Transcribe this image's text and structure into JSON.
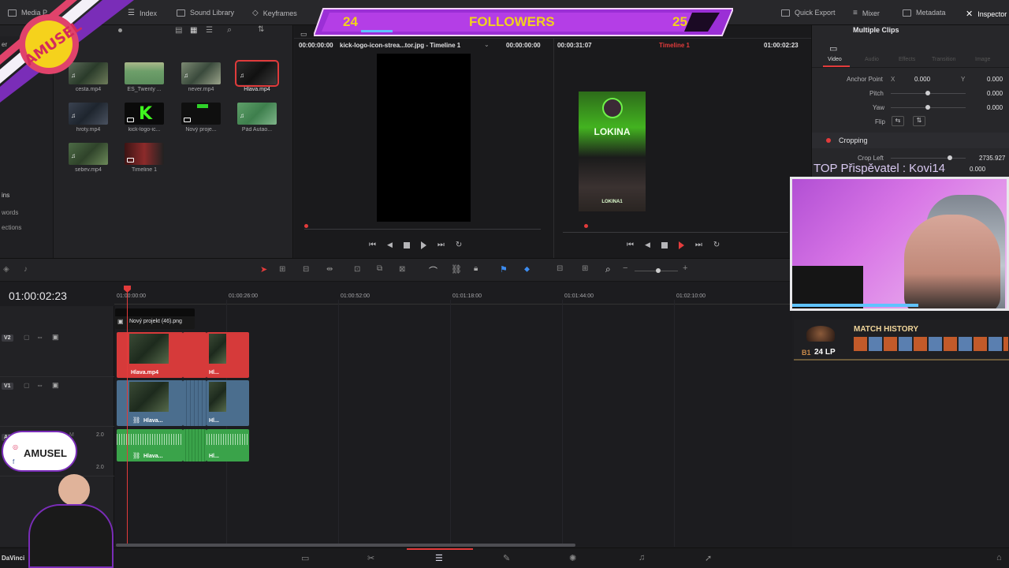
{
  "topbar": {
    "media_pool": "Media P",
    "index": "Index",
    "sound_library": "Sound Library",
    "keyframes": "Keyframes",
    "quick_export": "Quick Export",
    "mixer": "Mixer",
    "metadata": "Metadata",
    "inspector": "Inspector"
  },
  "overlay": {
    "followers_left": "24",
    "followers_title": "FOLLOWERS",
    "followers_right": "25",
    "top_donor": "TOP Přispěvatel : Kovi14",
    "top_donor_value": "0.000"
  },
  "media_pool": {
    "clips": [
      {
        "label": "cesta.mp4"
      },
      {
        "label": "ES_Twenty ..."
      },
      {
        "label": "never.mp4"
      },
      {
        "label": "Hlava.mp4"
      },
      {
        "label": "hroty.mp4"
      },
      {
        "label": "kick-logo-ic..."
      },
      {
        "label": "Nový proje..."
      },
      {
        "label": "Pád Autao..."
      },
      {
        "label": "sebev.mp4"
      },
      {
        "label": "Timeline 1"
      }
    ],
    "nav": {
      "bins": "ins",
      "keywords": "words",
      "collections": "ections"
    },
    "side_label": "er"
  },
  "viewer": {
    "src_timecode": "00:00:00:00",
    "src_name": "kick-logo-icon-strea...tor.jpg - Timeline 1",
    "src_tc2": "00:00:00:00",
    "tl_duration": "00:00:31:07",
    "tl_name": "Timeline 1",
    "tl_timecode": "01:00:02:23",
    "preview_name": "LOKINA",
    "preview_name2": "LOKINA1"
  },
  "inspector": {
    "title": "Multiple Clips",
    "tabs": [
      "Video",
      "Audio",
      "Effects",
      "Transition",
      "Image"
    ],
    "anchor_point": "Anchor Point",
    "anchor_x_label": "X",
    "anchor_x": "0.000",
    "anchor_y_label": "Y",
    "anchor_y": "0.000",
    "pitch": "Pitch",
    "pitch_val": "0.000",
    "yaw": "Yaw",
    "yaw_val": "0.000",
    "flip": "Flip",
    "cropping": "Cropping",
    "crop_left": "Crop Left",
    "crop_left_val": "2735.927"
  },
  "timeline": {
    "timecode": "01:00:02:23",
    "ruler": [
      "01:00:00:00",
      "01:00:26:00",
      "01:00:52:00",
      "01:01:18:00",
      "01:01:44:00",
      "01:02:10:00"
    ],
    "tracks": [
      {
        "name": "V2"
      },
      {
        "name": "V1"
      },
      {
        "name": "A1",
        "level": "2.0",
        "mute": "M"
      }
    ],
    "title_clip": "Nový projekt (46).png",
    "v2_clip1": "Hlava.mp4",
    "v2_clip2": "Hl...",
    "v1_clip1": "Hlava...",
    "v1_clip2": "Hl...",
    "a1_clip1": "Hlava...",
    "a1_clip2": "Hl...",
    "a1_level2": "2.0"
  },
  "match_history": {
    "title": "MATCH HISTORY",
    "rank": "B1",
    "lp": "24 LP"
  },
  "brand": {
    "logo_text": "AMUSEL",
    "social_name": "AMUSEL",
    "app_short": "DaVinci"
  },
  "colors": {
    "accent_red": "#e23b3b",
    "overlay_purple": "#9b2fd6",
    "overlay_yellow": "#f2d21c",
    "video_clip": "#4b6e8e",
    "audio_clip": "#3aa34a",
    "clip_red": "#d63a3a"
  }
}
